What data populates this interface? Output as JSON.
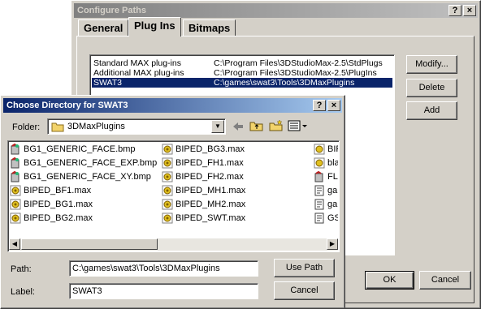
{
  "configure": {
    "title": "Configure Paths",
    "help_glyph": "?",
    "close_glyph": "×",
    "tabs": [
      {
        "label": "General"
      },
      {
        "label": "Plug Ins"
      },
      {
        "label": "Bitmaps"
      }
    ],
    "paths": [
      {
        "name": "Standard MAX plug-ins",
        "path": "C:\\Program Files\\3DStudioMax-2.5\\StdPlugs"
      },
      {
        "name": "Additional MAX plug-ins",
        "path": "C:\\Program Files\\3DStudioMax-2.5\\PlugIns"
      },
      {
        "name": "SWAT3",
        "path": "C:\\games\\swat3\\Tools\\3DMaxPlugins"
      }
    ],
    "buttons": {
      "modify": "Modify...",
      "delete": "Delete",
      "add": "Add",
      "ok": "OK",
      "cancel": "Cancel"
    }
  },
  "choose": {
    "title": "Choose Directory for SWAT3",
    "help_glyph": "?",
    "close_glyph": "×",
    "folder_label": "Folder:",
    "folder_value": "3DMaxPlugins",
    "files_col1": [
      {
        "name": "BG1_GENERIC_FACE.bmp",
        "icon": "bmp-file-icon"
      },
      {
        "name": "BG1_GENERIC_FACE_EXP.bmp",
        "icon": "bmp-file-icon"
      },
      {
        "name": "BG1_GENERIC_FACE_XY.bmp",
        "icon": "bmp-file-icon"
      },
      {
        "name": "BIPED_BF1.max",
        "icon": "max-file-icon"
      },
      {
        "name": "BIPED_BG1.max",
        "icon": "max-file-icon"
      },
      {
        "name": "BIPED_BG2.max",
        "icon": "max-file-icon"
      }
    ],
    "files_col2": [
      {
        "name": "BIPED_BG3.max",
        "icon": "max-file-icon"
      },
      {
        "name": "BIPED_FH1.max",
        "icon": "max-file-icon"
      },
      {
        "name": "BIPED_FH2.max",
        "icon": "max-file-icon"
      },
      {
        "name": "BIPED_MH1.max",
        "icon": "max-file-icon"
      },
      {
        "name": "BIPED_MH2.max",
        "icon": "max-file-icon"
      },
      {
        "name": "BIPED_SWT.max",
        "icon": "max-file-icon"
      }
    ],
    "files_col3": [
      {
        "name": "BIP",
        "icon": "max-file-icon"
      },
      {
        "name": "bla",
        "icon": "max-file-icon"
      },
      {
        "name": "FLC",
        "icon": "bmp-file-icon"
      },
      {
        "name": "gar",
        "icon": "doc-file-icon"
      },
      {
        "name": "gar",
        "icon": "doc-file-icon"
      },
      {
        "name": "GSI",
        "icon": "doc-file-icon"
      }
    ],
    "path_label": "Path:",
    "path_value": "C:\\games\\swat3\\Tools\\3DMaxPlugins",
    "label_label": "Label:",
    "label_value": "SWAT3",
    "use_path": "Use Path",
    "cancel": "Cancel"
  }
}
